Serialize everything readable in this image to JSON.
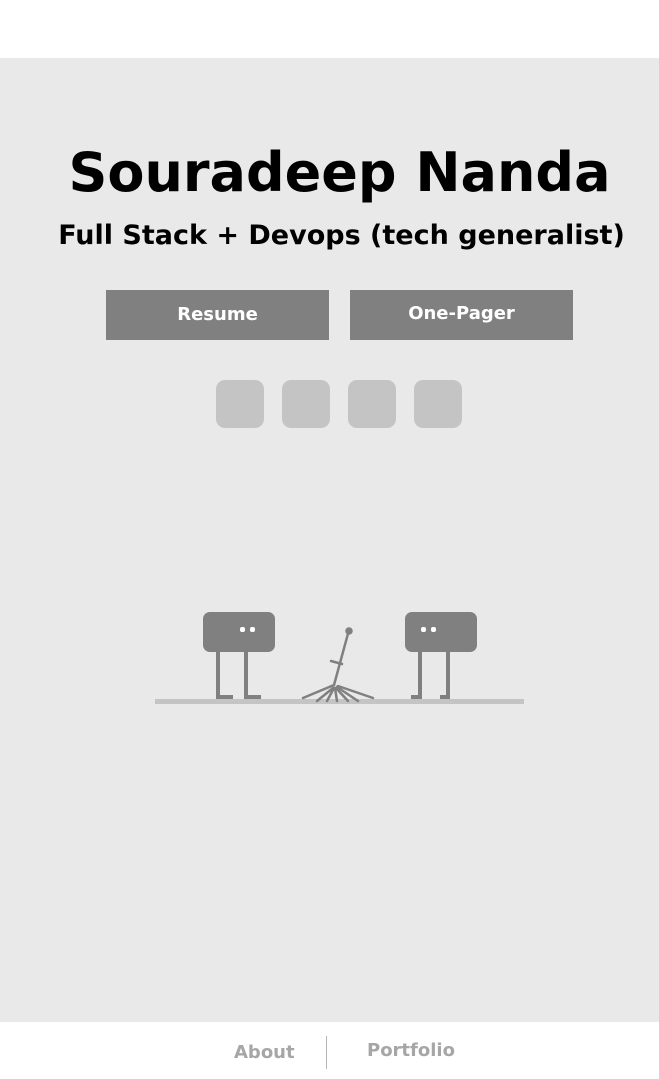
{
  "header": {
    "name": "Souradeep Nanda",
    "tagline": "Full Stack + Devops (tech generalist)"
  },
  "buttons": {
    "resume": "Resume",
    "one_pager": "One-Pager"
  },
  "social_icons": [
    "social-icon-1",
    "social-icon-2",
    "social-icon-3",
    "social-icon-4"
  ],
  "illustration": {
    "description_icons": [
      "robot-left",
      "sword-in-ground",
      "robot-right",
      "ground-line"
    ]
  },
  "footer": {
    "about": "About",
    "portfolio": "Portfolio"
  },
  "colors": {
    "background": "#e9e9e9",
    "button": "#808080",
    "icon_placeholder": "#c4c4c4",
    "nav_text": "#a6a6a6"
  }
}
